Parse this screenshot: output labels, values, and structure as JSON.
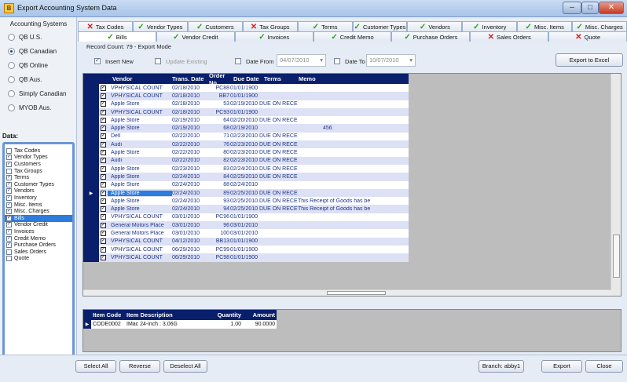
{
  "window": {
    "title": "Export Accounting System Data",
    "icon_text": "B"
  },
  "left": {
    "header": "Accounting Systems",
    "systems": [
      {
        "label": "QB U.S.",
        "selected": false
      },
      {
        "label": "QB Canadian",
        "selected": true
      },
      {
        "label": "QB Online",
        "selected": false
      },
      {
        "label": "QB Aus.",
        "selected": false
      },
      {
        "label": "Simply Canadian",
        "selected": false
      },
      {
        "label": "MYOB Aus.",
        "selected": false
      }
    ],
    "data_label": "Data:",
    "data_items": [
      {
        "label": "Tax Codes",
        "checked": false,
        "selected": false
      },
      {
        "label": "Vendor Types",
        "checked": true,
        "selected": false
      },
      {
        "label": "Customers",
        "checked": true,
        "selected": false
      },
      {
        "label": "Tax Groups",
        "checked": false,
        "selected": false
      },
      {
        "label": "Terms",
        "checked": true,
        "selected": false
      },
      {
        "label": "Customer Types",
        "checked": true,
        "selected": false
      },
      {
        "label": "Vendors",
        "checked": true,
        "selected": false
      },
      {
        "label": "Inventory",
        "checked": true,
        "selected": false
      },
      {
        "label": "Misc. Items",
        "checked": true,
        "selected": false
      },
      {
        "label": "Misc. Charges",
        "checked": true,
        "selected": false
      },
      {
        "label": "Bills",
        "checked": true,
        "selected": true
      },
      {
        "label": "Vendor Credit",
        "checked": true,
        "selected": false
      },
      {
        "label": "Invoices",
        "checked": true,
        "selected": false
      },
      {
        "label": "Credit Memo",
        "checked": true,
        "selected": false
      },
      {
        "label": "Purchase Orders",
        "checked": true,
        "selected": false
      },
      {
        "label": "Sales Orders",
        "checked": false,
        "selected": false
      },
      {
        "label": "Quote",
        "checked": false,
        "selected": false
      }
    ]
  },
  "tabs_row1": [
    {
      "label": "Tax Codes",
      "ok": false
    },
    {
      "label": "Vendor Types",
      "ok": true
    },
    {
      "label": "Customers",
      "ok": true
    },
    {
      "label": "Tax Groups",
      "ok": false
    },
    {
      "label": "Terms",
      "ok": true
    },
    {
      "label": "Customer Types",
      "ok": true
    },
    {
      "label": "Vendors",
      "ok": true
    },
    {
      "label": "Inventory",
      "ok": true
    },
    {
      "label": "Misc. Items",
      "ok": true
    },
    {
      "label": "Misc. Charges",
      "ok": true
    }
  ],
  "tabs_row2": [
    {
      "label": "Bills",
      "ok": true,
      "active": true
    },
    {
      "label": "Vendor Credit",
      "ok": true,
      "active": false
    },
    {
      "label": "Invoices",
      "ok": true,
      "active": false
    },
    {
      "label": "Credit Memo",
      "ok": true,
      "active": false
    },
    {
      "label": "Purchase Orders",
      "ok": true,
      "active": false
    },
    {
      "label": "Sales Orders",
      "ok": false,
      "active": false
    },
    {
      "label": "Quote",
      "ok": false,
      "active": false
    }
  ],
  "options": {
    "record_count": "Record Count: 79 - Export Mode",
    "insert_new": "Insert New",
    "update_existing": "Update Existing",
    "date_from_label": "Date From",
    "date_from": "04/07/2010",
    "date_to_label": "Date To",
    "date_to": "10/07/2010",
    "export_excel": "Export to Excel"
  },
  "grid": {
    "headers": {
      "vendor": "Vendor",
      "trans_date": "Trans. Date",
      "order_no": "Order No.",
      "due_date": "Due Date",
      "terms": "Terms",
      "memo": "Memo"
    },
    "rows": [
      {
        "vendor": "VPHYSICAL COUNT",
        "trans": "02/18/2010",
        "order": "PC88",
        "due": "01/01/1900",
        "terms": "",
        "memo": ""
      },
      {
        "vendor": "VPHYSICAL COUNT",
        "trans": "02/18/2010",
        "order": "BB7",
        "due": "01/01/1900",
        "terms": "",
        "memo": ""
      },
      {
        "vendor": "Apple Store",
        "trans": "02/18/2010",
        "order": "53",
        "due": "02/19/2010",
        "terms": "DUE ON RECE",
        "memo": ""
      },
      {
        "vendor": "VPHYSICAL COUNT",
        "trans": "02/18/2010",
        "order": "PC93",
        "due": "01/01/1900",
        "terms": "",
        "memo": ""
      },
      {
        "vendor": "Apple Store",
        "trans": "02/19/2010",
        "order": "64",
        "due": "02/20/2010",
        "terms": "DUE ON RECE",
        "memo": ""
      },
      {
        "vendor": "Apple Store",
        "trans": "02/19/2010",
        "order": "68",
        "due": "02/19/2010",
        "terms": "",
        "memo": "456"
      },
      {
        "vendor": "Dell",
        "trans": "02/22/2010",
        "order": "71",
        "due": "02/23/2010",
        "terms": "DUE ON RECE",
        "memo": ""
      },
      {
        "vendor": "Audi",
        "trans": "02/22/2010",
        "order": "76",
        "due": "02/23/2010",
        "terms": "DUE ON RECE",
        "memo": ""
      },
      {
        "vendor": "Apple Store",
        "trans": "02/22/2010",
        "order": "80",
        "due": "02/23/2010",
        "terms": "DUE ON RECE",
        "memo": ""
      },
      {
        "vendor": "Audi",
        "trans": "02/22/2010",
        "order": "82",
        "due": "02/23/2010",
        "terms": "DUE ON RECE",
        "memo": ""
      },
      {
        "vendor": "Apple Store",
        "trans": "02/23/2010",
        "order": "83",
        "due": "02/24/2010",
        "terms": "DUE ON RECE",
        "memo": ""
      },
      {
        "vendor": "Apple Store",
        "trans": "02/24/2010",
        "order": "84",
        "due": "02/25/2010",
        "terms": "DUE ON RECE",
        "memo": ""
      },
      {
        "vendor": "Apple Store",
        "trans": "02/24/2010",
        "order": "88",
        "due": "02/24/2010",
        "terms": "",
        "memo": ""
      },
      {
        "vendor": "Apple Store",
        "trans": "02/24/2010",
        "order": "89",
        "due": "02/25/2010",
        "terms": "DUE ON RECE",
        "memo": "",
        "current": true
      },
      {
        "vendor": "Apple Store",
        "trans": "02/24/2010",
        "order": "93",
        "due": "02/25/2010",
        "terms": "DUE ON RECE",
        "memo": "This Receipt of Goods has be"
      },
      {
        "vendor": "Apple Store",
        "trans": "02/24/2010",
        "order": "94",
        "due": "02/25/2010",
        "terms": "DUE ON RECE",
        "memo": "This Receipt of Goods has be"
      },
      {
        "vendor": "VPHYSICAL COUNT",
        "trans": "03/01/2010",
        "order": "PC96",
        "due": "01/01/1900",
        "terms": "",
        "memo": ""
      },
      {
        "vendor": "General Motors Place",
        "trans": "03/01/2010",
        "order": "96",
        "due": "03/01/2010",
        "terms": "",
        "memo": ""
      },
      {
        "vendor": "General Motors Place",
        "trans": "03/01/2010",
        "order": "100",
        "due": "03/01/2010",
        "terms": "",
        "memo": ""
      },
      {
        "vendor": "VPHYSICAL COUNT",
        "trans": "04/12/2010",
        "order": "BB13",
        "due": "01/01/1900",
        "terms": "",
        "memo": ""
      },
      {
        "vendor": "VPHYSICAL COUNT",
        "trans": "06/29/2010",
        "order": "PC99",
        "due": "01/01/1900",
        "terms": "",
        "memo": ""
      },
      {
        "vendor": "VPHYSICAL COUNT",
        "trans": "06/29/2010",
        "order": "PC98",
        "due": "01/01/1900",
        "terms": "",
        "memo": ""
      }
    ]
  },
  "items": {
    "headers": {
      "code": "Item Code",
      "desc": "Item Description",
      "qty": "Quantity",
      "amount": "Amount"
    },
    "rows": [
      {
        "code": "CODE0002",
        "desc": "IMac 24-inch : 3.06G",
        "qty": "1.00",
        "amount": "90.0000"
      }
    ]
  },
  "footer": {
    "select_all": "Select All",
    "reverse": "Reverse",
    "deselect_all": "Deselect All",
    "branch": "Branch: abby1",
    "export": "Export",
    "close": "Close"
  }
}
